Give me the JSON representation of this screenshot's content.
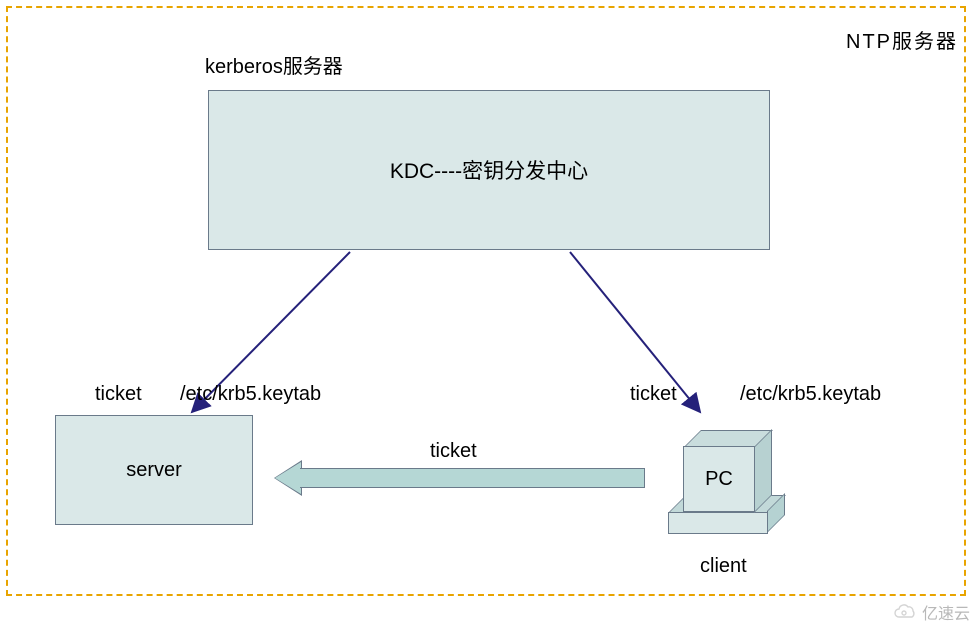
{
  "border_label": "NTP服务器",
  "kerberos_label": "kerberos服务器",
  "kdc": {
    "text": "KDC----密钥分发中心"
  },
  "server": {
    "text": "server"
  },
  "ticket_label": "ticket",
  "keytab_path": "/etc/krb5.keytab",
  "middle_arrow_label": "ticket",
  "pc": {
    "text": "PC"
  },
  "client_label": "client",
  "watermark": "亿速云",
  "colors": {
    "border": "#e8a400",
    "box_fill": "#dae8e8",
    "box_stroke": "#6a7a8a",
    "arrow_line": "#25217a"
  },
  "chart_data": {
    "type": "diagram",
    "title": "Kerberos authentication flow within NTP server boundary",
    "nodes": [
      {
        "id": "kdc",
        "label": "KDC----密钥分发中心",
        "role": "kerberos服务器"
      },
      {
        "id": "server",
        "label": "server"
      },
      {
        "id": "client",
        "label": "PC",
        "role": "client"
      }
    ],
    "edges": [
      {
        "from": "kdc",
        "to": "server",
        "label": "ticket /etc/krb5.keytab",
        "style": "thin-arrow"
      },
      {
        "from": "kdc",
        "to": "client",
        "label": "ticket /etc/krb5.keytab",
        "style": "thin-arrow"
      },
      {
        "from": "client",
        "to": "server",
        "label": "ticket",
        "style": "block-arrow"
      }
    ],
    "container": {
      "label": "NTP服务器",
      "style": "orange-dashed-border"
    }
  }
}
